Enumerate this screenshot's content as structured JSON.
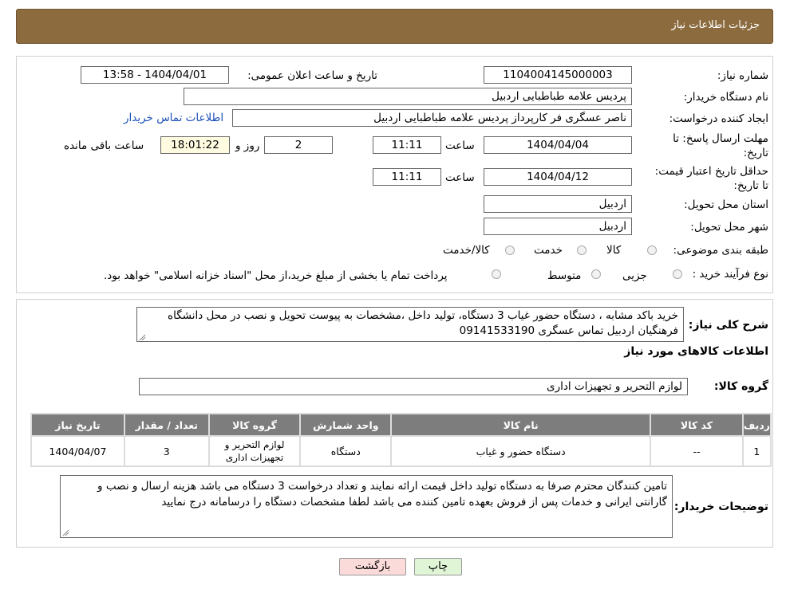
{
  "header": {
    "title": "جزئیات اطلاعات نیاز"
  },
  "fields": {
    "need_number_label": "شماره نیاز:",
    "need_number": "1104004145000003",
    "announce_label": "تاریخ و ساعت اعلان عمومی:",
    "announce_value": "1404/04/01 - 13:58",
    "buyer_org_label": "نام دستگاه خریدار:",
    "buyer_org": "پردیس علامه طباطبایی اردبیل",
    "creator_label": "ایجاد کننده درخواست:",
    "creator": "ناصر عسگری فر کارپرداز پردیس علامه طباطبایی اردبیل",
    "contact_link": "اطلاعات تماس خریدار",
    "deadline_label": "مهلت ارسال پاسخ: تا تاریخ:",
    "deadline_date": "1404/04/04",
    "time_label": "ساعت",
    "deadline_time": "11:11",
    "days": "2",
    "days_label": "روز و",
    "remaining_time": "18:01:22",
    "remaining_label": "ساعت باقی مانده",
    "validity_label": "حداقل تاریخ اعتبار قیمت: تا تاریخ:",
    "validity_date": "1404/04/12",
    "validity_time": "11:11",
    "province_label": "استان محل تحویل:",
    "province": "اردبیل",
    "city_label": "شهر محل تحویل:",
    "city": "اردبیل",
    "category_label": "طبقه بندی موضوعی:",
    "category_options": [
      "کالا",
      "خدمت",
      "کالا/خدمت"
    ],
    "process_label": "نوع فرآیند خرید :",
    "process_options": [
      "جزیی",
      "متوسط"
    ],
    "process_note": "پرداخت تمام یا بخشی از مبلغ خرید،از محل \"اسناد خزانه اسلامی\" خواهد بود."
  },
  "description": {
    "label": "شرح کلی نیاز:",
    "text": "خرید باکد مشابه ، دستگاه حضور غیاب 3 دستگاه، تولید داخل ،مشخصات به پیوست تحویل و نصب در محل دانشگاه فرهنگیان اردبیل تماس  عسگری 09141533190"
  },
  "goods": {
    "section_title": "اطلاعات کالاهای مورد نیاز",
    "group_label": "گروه کالا:",
    "group_value": "لوازم التحریر و تجهیزات اداری",
    "columns": [
      "ردیف",
      "کد کالا",
      "نام کالا",
      "واحد شمارش",
      "گروه کالا",
      "تعداد / مقدار",
      "تاریخ نیاز"
    ],
    "rows": [
      [
        "1",
        "--",
        "دستگاه حضور و غیاب",
        "دستگاه",
        "لوازم التحریر و تجهیزات اداری",
        "3",
        "1404/04/07"
      ]
    ]
  },
  "buyer_notes": {
    "label": "توضیحات خریدار:",
    "text": "تامین کنندگان محترم صرفا به دستگاه تولید داخل قیمت ارائه نمایند و تعداد درخواست 3 دستگاه می باشد هزینه ارسال و نصب و گارانتی ایرانی و خدمات پس از فروش بعهده تامین کننده می باشد لطفا مشخصات دستگاه را درسامانه درج نمایید"
  },
  "buttons": {
    "print": "چاپ",
    "back": "بازگشت"
  },
  "colors": {
    "header_bg": "#8c6b3f",
    "table_header_bg": "#7d7d7d",
    "print_btn_bg": "#dff5d6",
    "back_btn_bg": "#fbdada",
    "link": "#1c4fb8"
  }
}
